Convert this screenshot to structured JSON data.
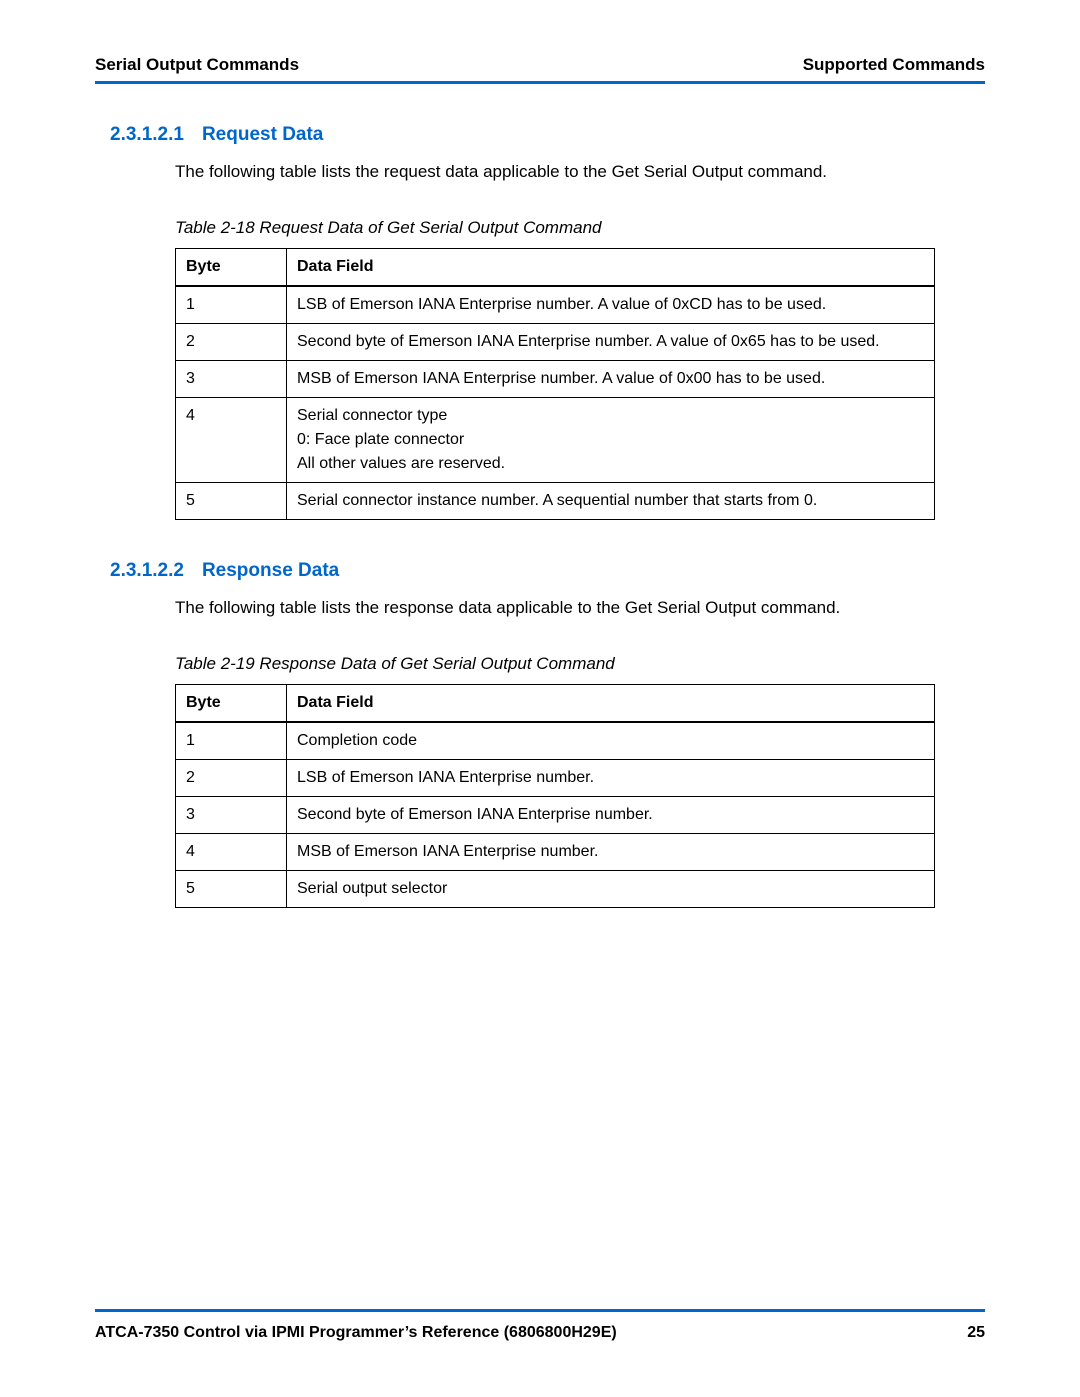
{
  "header": {
    "left": "Serial Output Commands",
    "right": "Supported Commands"
  },
  "sections": [
    {
      "number": "2.3.1.2.1",
      "title": "Request Data",
      "intro": "The following table lists the request data applicable to the Get Serial Output command.",
      "tableCaption": "Table 2-18 Request Data of Get Serial Output Command",
      "columns": {
        "byte": "Byte",
        "field": "Data Field"
      },
      "rows": [
        {
          "byte": "1",
          "field": "LSB of Emerson IANA Enterprise number. A value of 0xCD has to be used."
        },
        {
          "byte": "2",
          "field": "Second byte of Emerson IANA Enterprise number. A value of 0x65 has to be used."
        },
        {
          "byte": "3",
          "field": "MSB of Emerson IANA Enterprise number. A value of 0x00 has to be used."
        },
        {
          "byte": "4",
          "field": "Serial connector type\n0: Face plate connector\nAll other values are reserved."
        },
        {
          "byte": "5",
          "field": "Serial connector instance number. A sequential number that starts from 0."
        }
      ]
    },
    {
      "number": "2.3.1.2.2",
      "title": "Response Data",
      "intro": "The following table lists the response data applicable to the Get Serial Output command.",
      "tableCaption": "Table 2-19 Response Data of Get Serial Output Command",
      "columns": {
        "byte": "Byte",
        "field": "Data Field"
      },
      "rows": [
        {
          "byte": "1",
          "field": "Completion code"
        },
        {
          "byte": "2",
          "field": "LSB of Emerson IANA Enterprise number."
        },
        {
          "byte": "3",
          "field": "Second byte of Emerson IANA Enterprise number."
        },
        {
          "byte": "4",
          "field": "MSB of Emerson IANA Enterprise number."
        },
        {
          "byte": "5",
          "field": "Serial output selector"
        }
      ]
    }
  ],
  "footer": {
    "left": "ATCA-7350 Control via IPMI Programmer’s Reference (6806800H29E)",
    "right": "25"
  }
}
